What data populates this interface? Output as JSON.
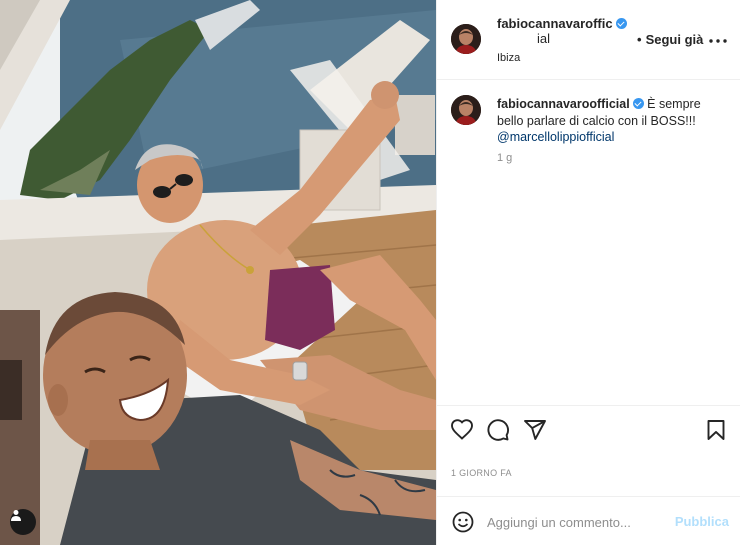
{
  "post": {
    "username": "fabiocannavaroofficial",
    "username_line1": "fabiocannavaroffic",
    "username_line2": "ial",
    "follow_separator": "•",
    "follow_status": "Segui già",
    "more_icon": "more-horizontal-icon",
    "location": "Ibiza"
  },
  "caption": {
    "username": "fabiocannavaroofficial",
    "text": "È sempre bello parlare di calcio con il BOSS!!!",
    "mention": "@marcellolippiofficial",
    "time_ago": "1 g"
  },
  "actions": {
    "like_icon": "heart-icon",
    "comment_icon": "comment-icon",
    "share_icon": "send-icon",
    "save_icon": "bookmark-icon"
  },
  "date_label": "1 GIORNO FA",
  "comment_box": {
    "placeholder": "Aggiungi un commento...",
    "publish_label": "Pubblica",
    "emoji_icon": "emoji-icon"
  },
  "photo": {
    "tag_icon": "user-tag-icon"
  },
  "colors": {
    "verified": "#3897f0",
    "mention": "#00376b",
    "publish_disabled": "#b2dffc",
    "secondary_text": "#8e8e8e"
  }
}
